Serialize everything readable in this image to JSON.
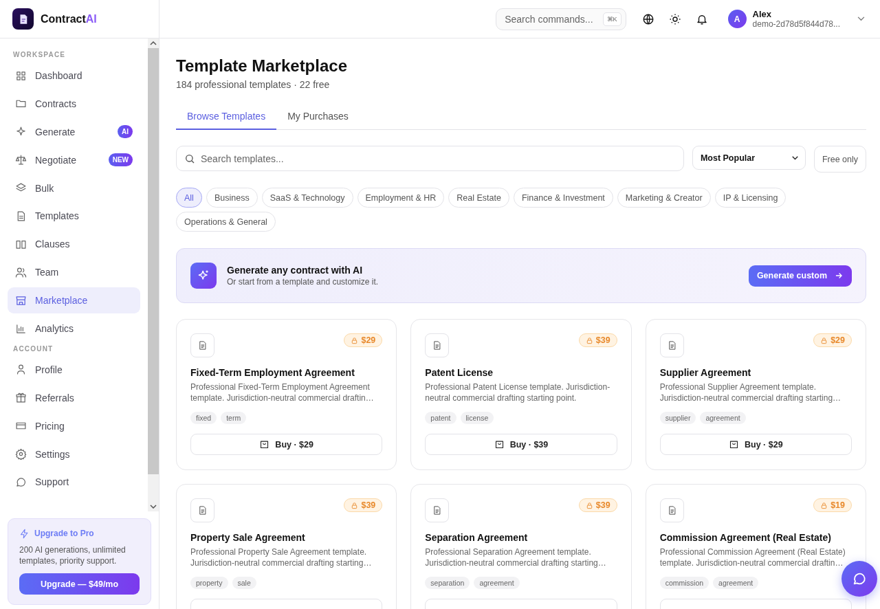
{
  "brand": {
    "name": "Contract",
    "accent": "AI"
  },
  "sidebar": {
    "sections": [
      {
        "heading": "WORKSPACE",
        "items": [
          {
            "label": "Dashboard",
            "selected": false
          },
          {
            "label": "Contracts",
            "selected": false
          },
          {
            "label": "Generate",
            "selected": false,
            "badge": "AI"
          },
          {
            "label": "Negotiate",
            "selected": false,
            "badge": "NEW"
          },
          {
            "label": "Bulk",
            "selected": false
          },
          {
            "label": "Templates",
            "selected": false
          },
          {
            "label": "Clauses",
            "selected": false
          },
          {
            "label": "Team",
            "selected": false
          },
          {
            "label": "Marketplace",
            "selected": true
          },
          {
            "label": "Analytics",
            "selected": false
          }
        ]
      },
      {
        "heading": "ACCOUNT",
        "items": [
          {
            "label": "Profile",
            "selected": false
          },
          {
            "label": "Referrals",
            "selected": false
          },
          {
            "label": "Pricing",
            "selected": false
          },
          {
            "label": "Settings",
            "selected": false
          },
          {
            "label": "Support",
            "selected": false
          }
        ]
      }
    ],
    "upgrade": {
      "title": "Upgrade to Pro",
      "text": "200 AI generations, unlimited templates, priority support.",
      "button": "Upgrade — $49/mo"
    }
  },
  "topbar": {
    "search": {
      "placeholder": "Search commands...",
      "shortcut": "⌘K"
    },
    "user": {
      "initial": "A",
      "name": "Alex",
      "email": "demo-2d78d5f844d78..."
    }
  },
  "page": {
    "title": "Template Marketplace",
    "subtitle": "184 professional templates · 22 free"
  },
  "tabs": [
    {
      "label": "Browse Templates",
      "selected": true
    },
    {
      "label": "My Purchases",
      "selected": false
    }
  ],
  "filters": {
    "search_placeholder": "Search templates...",
    "sort": "Most Popular",
    "free_only": {
      "label": "Free only",
      "on": false
    }
  },
  "categories": [
    {
      "label": "All",
      "selected": true
    },
    {
      "label": "Business",
      "selected": false
    },
    {
      "label": "SaaS & Technology",
      "selected": false
    },
    {
      "label": "Employment & HR",
      "selected": false
    },
    {
      "label": "Real Estate",
      "selected": false
    },
    {
      "label": "Finance & Investment",
      "selected": false
    },
    {
      "label": "Marketing & Creator",
      "selected": false
    },
    {
      "label": "IP & Licensing",
      "selected": false
    },
    {
      "label": "Operations & General",
      "selected": false
    }
  ],
  "ai_banner": {
    "title": "Generate any contract with AI",
    "text": "Or start from a template and customize it.",
    "button": "Generate custom"
  },
  "templates": [
    {
      "price": "$29",
      "title": "Fixed-Term Employment Agreement",
      "description": "Professional Fixed-Term Employment Agreement template. Jurisdiction-neutral commercial draftin…",
      "tags": [
        "fixed",
        "term"
      ],
      "buy": "Buy · $29"
    },
    {
      "price": "$39",
      "title": "Patent License",
      "description": "Professional Patent License template. Jurisdiction-neutral commercial drafting starting point.",
      "tags": [
        "patent",
        "license"
      ],
      "buy": "Buy · $39"
    },
    {
      "price": "$29",
      "title": "Supplier Agreement",
      "description": "Professional Supplier Agreement template. Jurisdiction-neutral commercial drafting starting…",
      "tags": [
        "supplier",
        "agreement"
      ],
      "buy": "Buy · $29"
    },
    {
      "price": "$39",
      "title": "Property Sale Agreement",
      "description": "Professional Property Sale Agreement template. Jurisdiction-neutral commercial drafting starting…",
      "tags": [
        "property",
        "sale"
      ]
    },
    {
      "price": "$39",
      "title": "Separation Agreement",
      "description": "Professional Separation Agreement template. Jurisdiction-neutral commercial drafting starting…",
      "tags": [
        "separation",
        "agreement"
      ]
    },
    {
      "price": "$19",
      "title": "Commission Agreement (Real Estate)",
      "description": "Professional Commission Agreement (Real Estate) template. Jurisdiction-neutral commercial draftin…",
      "tags": [
        "commission",
        "agreement"
      ]
    }
  ]
}
